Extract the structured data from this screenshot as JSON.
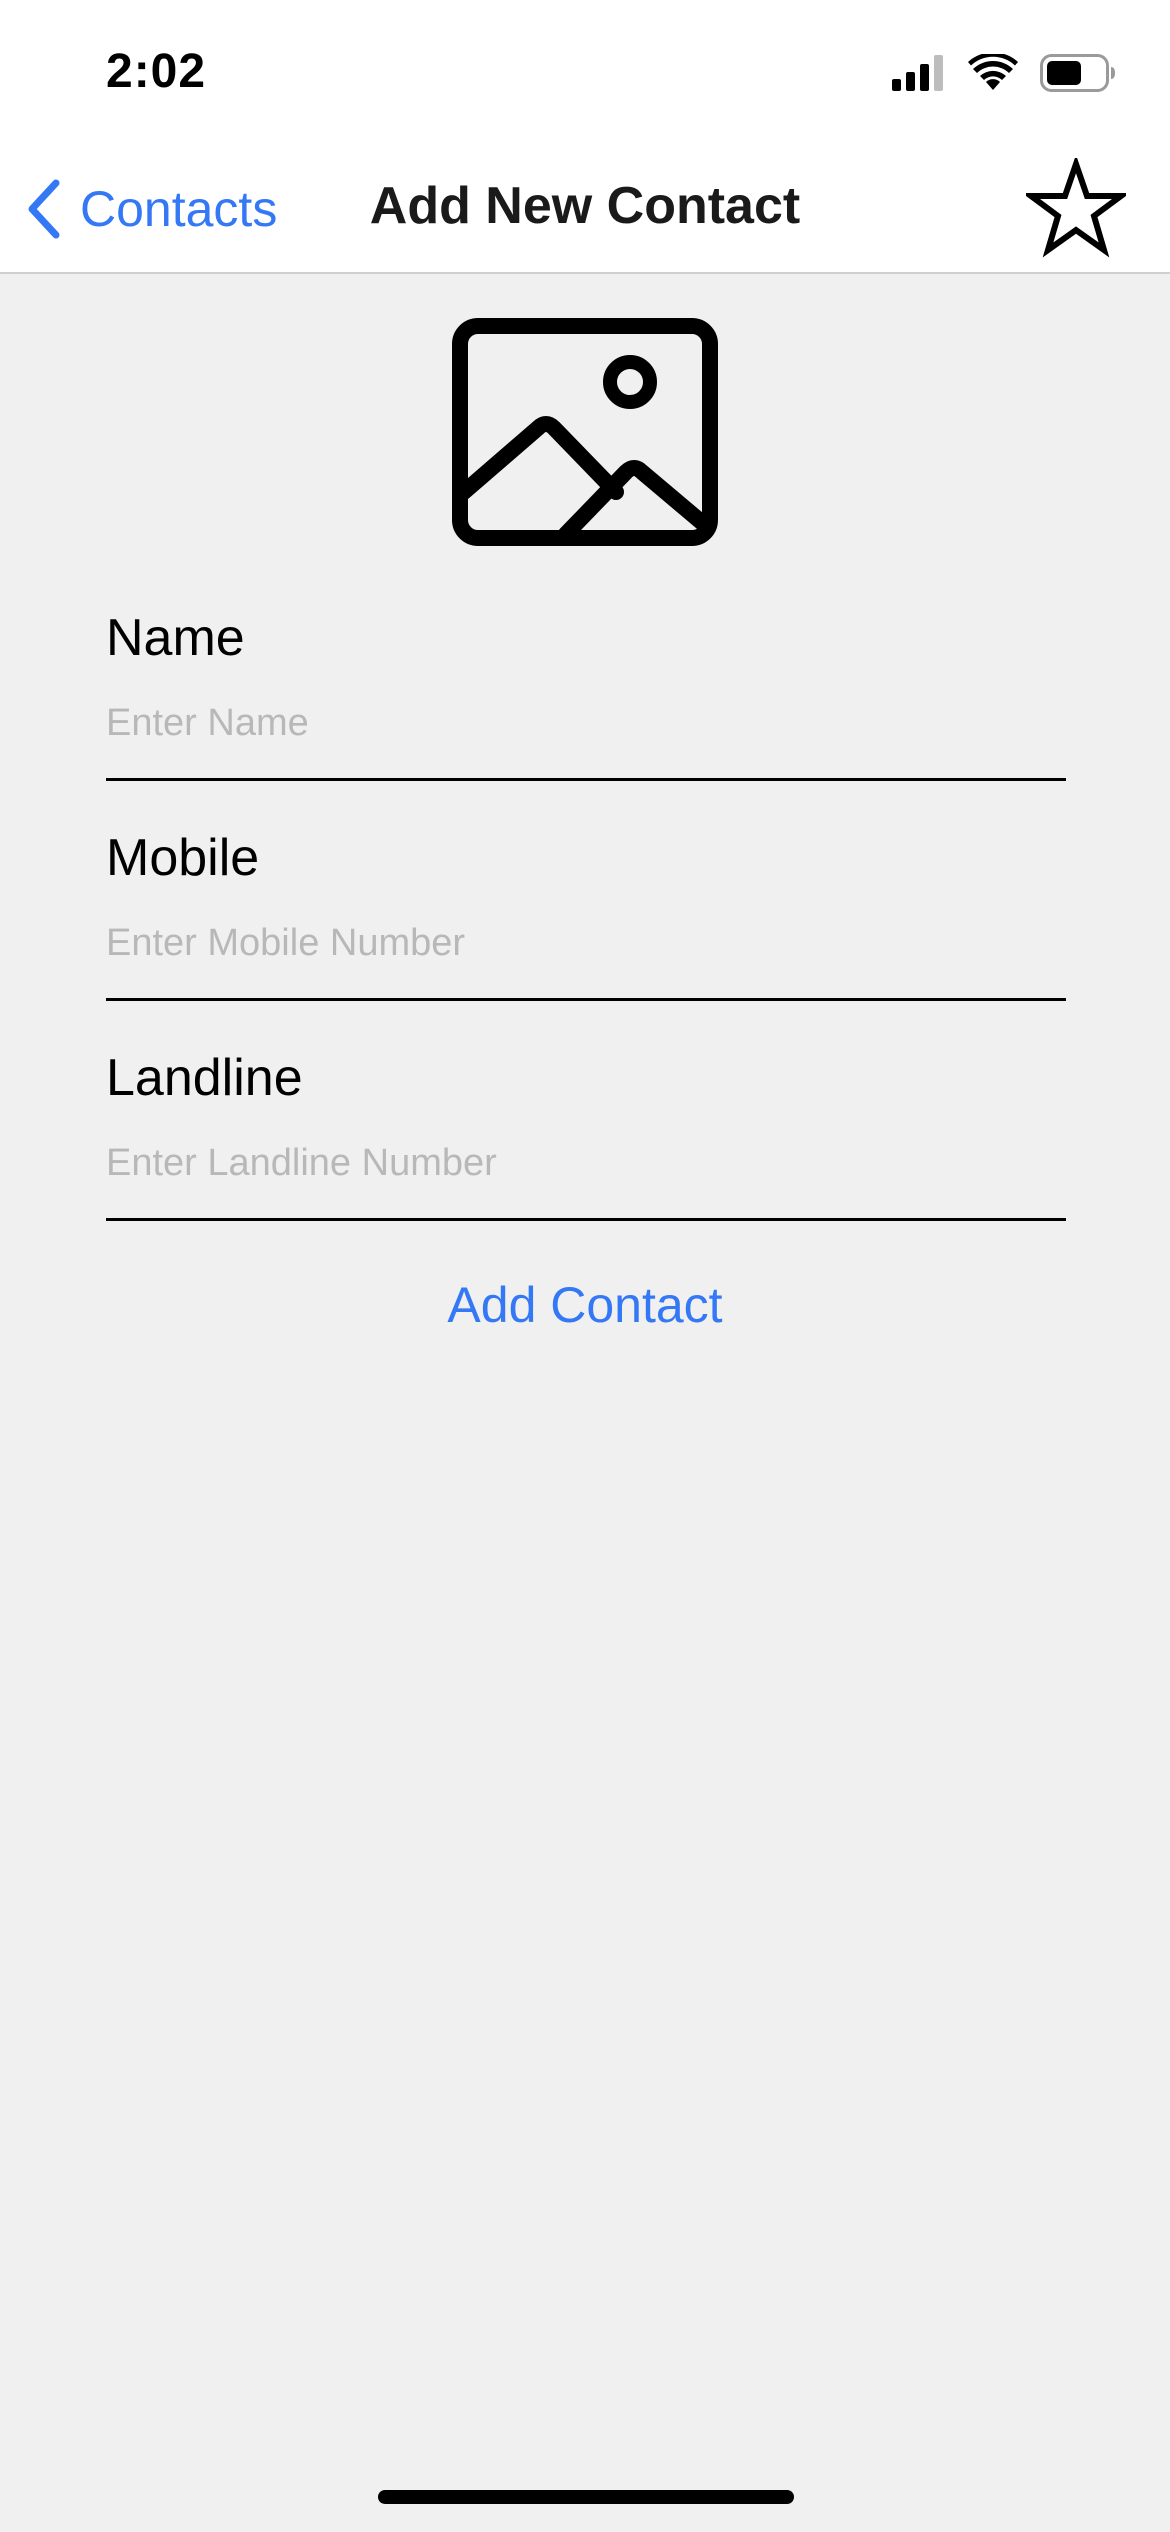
{
  "status_bar": {
    "time": "2:02",
    "icons": [
      "signal-icon",
      "wifi-icon",
      "battery-icon"
    ]
  },
  "nav": {
    "back_label": "Contacts",
    "title": "Add New Contact",
    "right_icon": "star-icon"
  },
  "photo": {
    "icon": "image-placeholder-icon"
  },
  "form": {
    "name": {
      "label": "Name",
      "placeholder": "Enter Name",
      "value": ""
    },
    "mobile": {
      "label": "Mobile",
      "placeholder": "Enter Mobile Number",
      "value": ""
    },
    "landline": {
      "label": "Landline",
      "placeholder": "Enter Landline Number",
      "value": ""
    },
    "submit_label": "Add Contact"
  },
  "colors": {
    "accent": "#3478f6",
    "background": "#f0f0f0",
    "bar_background": "#ffffff",
    "placeholder": "#b8b8b8"
  }
}
